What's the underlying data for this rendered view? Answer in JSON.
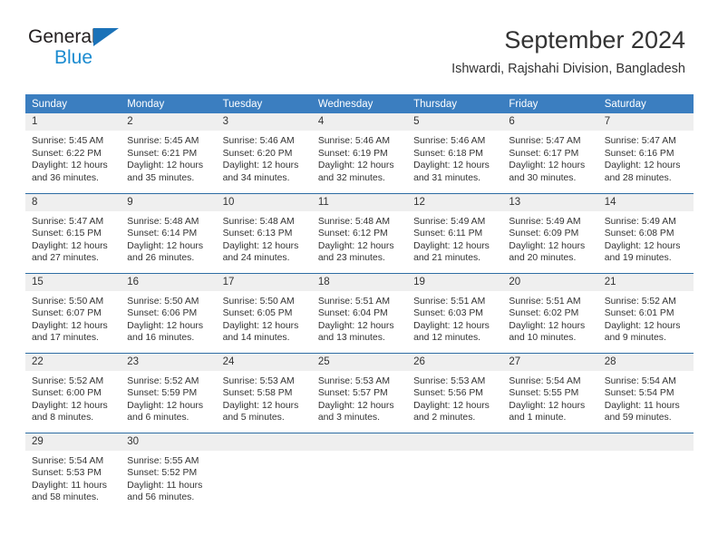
{
  "brand": {
    "line1": "General",
    "line2": "Blue",
    "triangle_color": "#1b72b8",
    "line2_color": "#1b8bd0"
  },
  "header": {
    "title": "September 2024",
    "subtitle": "Ishwardi, Rajshahi Division, Bangladesh"
  },
  "theme": {
    "header_bg": "#3b7ec0",
    "daynum_bg": "#efefef",
    "row_divider": "#2e6da4",
    "text": "#333333"
  },
  "calendar": {
    "weekday_headers": [
      "Sunday",
      "Monday",
      "Tuesday",
      "Wednesday",
      "Thursday",
      "Friday",
      "Saturday"
    ],
    "weeks": [
      [
        {
          "day": "1",
          "sunrise": "Sunrise: 5:45 AM",
          "sunset": "Sunset: 6:22 PM",
          "daylight1": "Daylight: 12 hours",
          "daylight2": "and 36 minutes."
        },
        {
          "day": "2",
          "sunrise": "Sunrise: 5:45 AM",
          "sunset": "Sunset: 6:21 PM",
          "daylight1": "Daylight: 12 hours",
          "daylight2": "and 35 minutes."
        },
        {
          "day": "3",
          "sunrise": "Sunrise: 5:46 AM",
          "sunset": "Sunset: 6:20 PM",
          "daylight1": "Daylight: 12 hours",
          "daylight2": "and 34 minutes."
        },
        {
          "day": "4",
          "sunrise": "Sunrise: 5:46 AM",
          "sunset": "Sunset: 6:19 PM",
          "daylight1": "Daylight: 12 hours",
          "daylight2": "and 32 minutes."
        },
        {
          "day": "5",
          "sunrise": "Sunrise: 5:46 AM",
          "sunset": "Sunset: 6:18 PM",
          "daylight1": "Daylight: 12 hours",
          "daylight2": "and 31 minutes."
        },
        {
          "day": "6",
          "sunrise": "Sunrise: 5:47 AM",
          "sunset": "Sunset: 6:17 PM",
          "daylight1": "Daylight: 12 hours",
          "daylight2": "and 30 minutes."
        },
        {
          "day": "7",
          "sunrise": "Sunrise: 5:47 AM",
          "sunset": "Sunset: 6:16 PM",
          "daylight1": "Daylight: 12 hours",
          "daylight2": "and 28 minutes."
        }
      ],
      [
        {
          "day": "8",
          "sunrise": "Sunrise: 5:47 AM",
          "sunset": "Sunset: 6:15 PM",
          "daylight1": "Daylight: 12 hours",
          "daylight2": "and 27 minutes."
        },
        {
          "day": "9",
          "sunrise": "Sunrise: 5:48 AM",
          "sunset": "Sunset: 6:14 PM",
          "daylight1": "Daylight: 12 hours",
          "daylight2": "and 26 minutes."
        },
        {
          "day": "10",
          "sunrise": "Sunrise: 5:48 AM",
          "sunset": "Sunset: 6:13 PM",
          "daylight1": "Daylight: 12 hours",
          "daylight2": "and 24 minutes."
        },
        {
          "day": "11",
          "sunrise": "Sunrise: 5:48 AM",
          "sunset": "Sunset: 6:12 PM",
          "daylight1": "Daylight: 12 hours",
          "daylight2": "and 23 minutes."
        },
        {
          "day": "12",
          "sunrise": "Sunrise: 5:49 AM",
          "sunset": "Sunset: 6:11 PM",
          "daylight1": "Daylight: 12 hours",
          "daylight2": "and 21 minutes."
        },
        {
          "day": "13",
          "sunrise": "Sunrise: 5:49 AM",
          "sunset": "Sunset: 6:09 PM",
          "daylight1": "Daylight: 12 hours",
          "daylight2": "and 20 minutes."
        },
        {
          "day": "14",
          "sunrise": "Sunrise: 5:49 AM",
          "sunset": "Sunset: 6:08 PM",
          "daylight1": "Daylight: 12 hours",
          "daylight2": "and 19 minutes."
        }
      ],
      [
        {
          "day": "15",
          "sunrise": "Sunrise: 5:50 AM",
          "sunset": "Sunset: 6:07 PM",
          "daylight1": "Daylight: 12 hours",
          "daylight2": "and 17 minutes."
        },
        {
          "day": "16",
          "sunrise": "Sunrise: 5:50 AM",
          "sunset": "Sunset: 6:06 PM",
          "daylight1": "Daylight: 12 hours",
          "daylight2": "and 16 minutes."
        },
        {
          "day": "17",
          "sunrise": "Sunrise: 5:50 AM",
          "sunset": "Sunset: 6:05 PM",
          "daylight1": "Daylight: 12 hours",
          "daylight2": "and 14 minutes."
        },
        {
          "day": "18",
          "sunrise": "Sunrise: 5:51 AM",
          "sunset": "Sunset: 6:04 PM",
          "daylight1": "Daylight: 12 hours",
          "daylight2": "and 13 minutes."
        },
        {
          "day": "19",
          "sunrise": "Sunrise: 5:51 AM",
          "sunset": "Sunset: 6:03 PM",
          "daylight1": "Daylight: 12 hours",
          "daylight2": "and 12 minutes."
        },
        {
          "day": "20",
          "sunrise": "Sunrise: 5:51 AM",
          "sunset": "Sunset: 6:02 PM",
          "daylight1": "Daylight: 12 hours",
          "daylight2": "and 10 minutes."
        },
        {
          "day": "21",
          "sunrise": "Sunrise: 5:52 AM",
          "sunset": "Sunset: 6:01 PM",
          "daylight1": "Daylight: 12 hours",
          "daylight2": "and 9 minutes."
        }
      ],
      [
        {
          "day": "22",
          "sunrise": "Sunrise: 5:52 AM",
          "sunset": "Sunset: 6:00 PM",
          "daylight1": "Daylight: 12 hours",
          "daylight2": "and 8 minutes."
        },
        {
          "day": "23",
          "sunrise": "Sunrise: 5:52 AM",
          "sunset": "Sunset: 5:59 PM",
          "daylight1": "Daylight: 12 hours",
          "daylight2": "and 6 minutes."
        },
        {
          "day": "24",
          "sunrise": "Sunrise: 5:53 AM",
          "sunset": "Sunset: 5:58 PM",
          "daylight1": "Daylight: 12 hours",
          "daylight2": "and 5 minutes."
        },
        {
          "day": "25",
          "sunrise": "Sunrise: 5:53 AM",
          "sunset": "Sunset: 5:57 PM",
          "daylight1": "Daylight: 12 hours",
          "daylight2": "and 3 minutes."
        },
        {
          "day": "26",
          "sunrise": "Sunrise: 5:53 AM",
          "sunset": "Sunset: 5:56 PM",
          "daylight1": "Daylight: 12 hours",
          "daylight2": "and 2 minutes."
        },
        {
          "day": "27",
          "sunrise": "Sunrise: 5:54 AM",
          "sunset": "Sunset: 5:55 PM",
          "daylight1": "Daylight: 12 hours",
          "daylight2": "and 1 minute."
        },
        {
          "day": "28",
          "sunrise": "Sunrise: 5:54 AM",
          "sunset": "Sunset: 5:54 PM",
          "daylight1": "Daylight: 11 hours",
          "daylight2": "and 59 minutes."
        }
      ],
      [
        {
          "day": "29",
          "sunrise": "Sunrise: 5:54 AM",
          "sunset": "Sunset: 5:53 PM",
          "daylight1": "Daylight: 11 hours",
          "daylight2": "and 58 minutes."
        },
        {
          "day": "30",
          "sunrise": "Sunrise: 5:55 AM",
          "sunset": "Sunset: 5:52 PM",
          "daylight1": "Daylight: 11 hours",
          "daylight2": "and 56 minutes."
        },
        {
          "day": "",
          "sunrise": "",
          "sunset": "",
          "daylight1": "",
          "daylight2": ""
        },
        {
          "day": "",
          "sunrise": "",
          "sunset": "",
          "daylight1": "",
          "daylight2": ""
        },
        {
          "day": "",
          "sunrise": "",
          "sunset": "",
          "daylight1": "",
          "daylight2": ""
        },
        {
          "day": "",
          "sunrise": "",
          "sunset": "",
          "daylight1": "",
          "daylight2": ""
        },
        {
          "day": "",
          "sunrise": "",
          "sunset": "",
          "daylight1": "",
          "daylight2": ""
        }
      ]
    ]
  }
}
